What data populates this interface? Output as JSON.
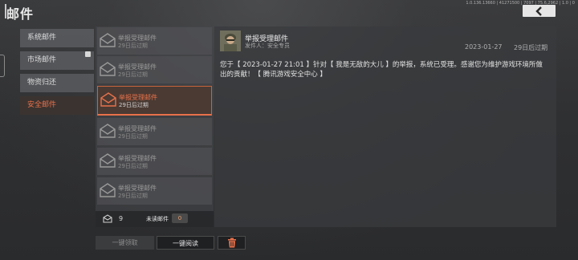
{
  "header": {
    "title": "邮件",
    "version": "1.0.136.13660 | 41271500 | 7097 | 75.6,2962 | 1.0 | 0"
  },
  "categories": [
    {
      "label": "系统邮件"
    },
    {
      "label": "市场邮件"
    },
    {
      "label": "物资归还"
    },
    {
      "label": "安全邮件"
    }
  ],
  "mails": [
    {
      "title": "举报受理邮件",
      "sub": "29日后过期"
    },
    {
      "title": "举报受理邮件",
      "sub": "29日后过期"
    },
    {
      "title": "举报受理邮件",
      "sub": "29日后过期"
    },
    {
      "title": "举报受理邮件",
      "sub": "29日后过期"
    },
    {
      "title": "举报受理邮件",
      "sub": "29日后过期"
    },
    {
      "title": "举报受理邮件",
      "sub": "29日后过期"
    }
  ],
  "footer": {
    "count": "9",
    "unread_label": "未读邮件",
    "unread_count": "0"
  },
  "detail": {
    "title": "举报受理邮件",
    "sender": "发件人：安全专员",
    "date": "2023-01-27",
    "expire": "29日后过期",
    "body": "您于【 2023-01-27 21:01 】针对【 我是无敌的大儿 】的举报，系统已受理。感谢您为维护游戏环境所做出的贡献！【 腾讯游戏安全中心 】"
  },
  "actions": {
    "claim_all": "一键领取",
    "read_all": "一键阅读"
  },
  "colors": {
    "accent": "#e8714a",
    "active_bg": "#4a3a33"
  }
}
